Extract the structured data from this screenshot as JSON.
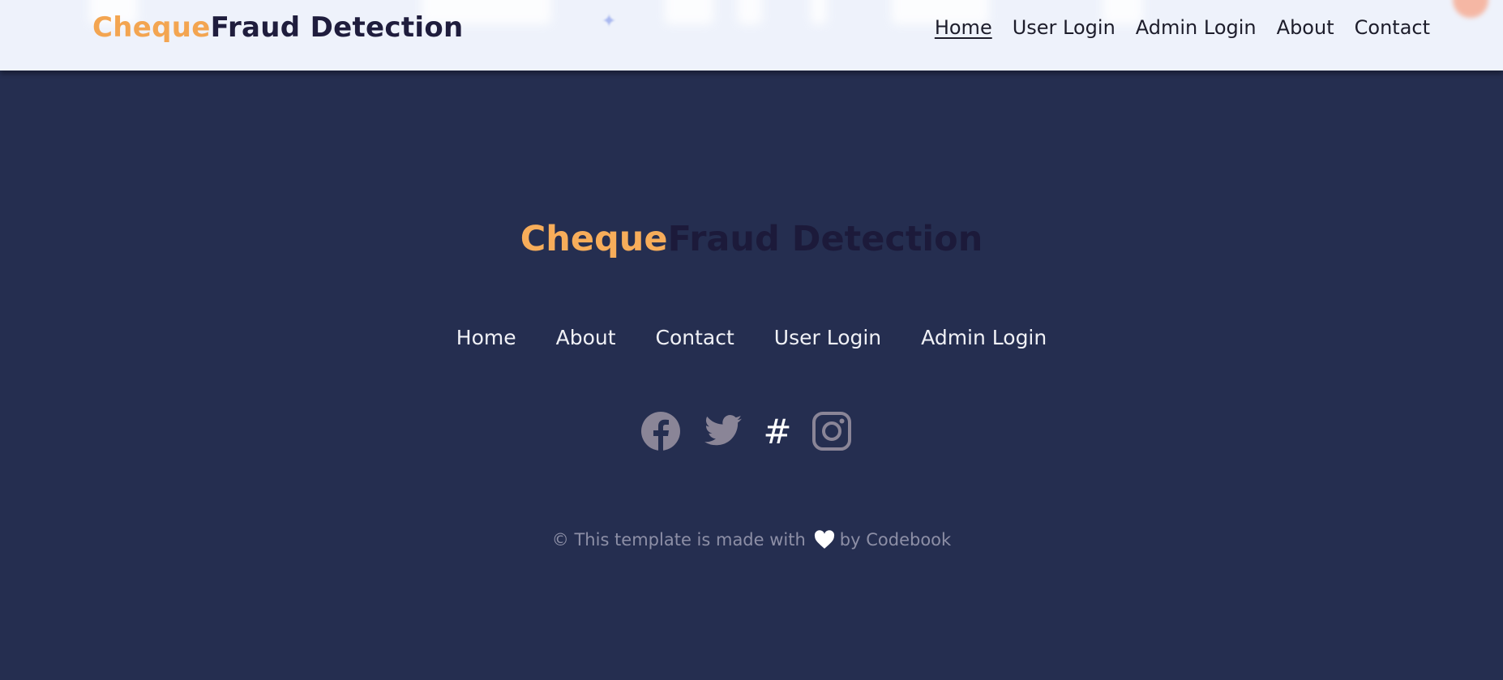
{
  "header": {
    "brand_accent": "Cheque",
    "brand_main": "Fraud Detection",
    "nav": [
      {
        "label": "Home",
        "active": true
      },
      {
        "label": "User Login"
      },
      {
        "label": "Admin Login"
      },
      {
        "label": "About"
      },
      {
        "label": "Contact"
      }
    ]
  },
  "footer": {
    "brand_accent": "Cheque",
    "brand_main": "Fraud Detection",
    "links": [
      "Home",
      "About",
      "Contact",
      "User Login",
      "Admin Login"
    ],
    "social": [
      {
        "icon": "facebook-icon"
      },
      {
        "icon": "twitter-icon"
      },
      {
        "icon": "hashtag-icon",
        "glyph": "#"
      },
      {
        "icon": "instagram-icon"
      }
    ],
    "credit_before": "© This template is made with",
    "credit_after": "by Codebook"
  },
  "colors": {
    "accent": "#f3a551",
    "brand_dark": "#1f1d3d",
    "footer_bg": "#252e50",
    "header_bg": "#eef2fb"
  }
}
